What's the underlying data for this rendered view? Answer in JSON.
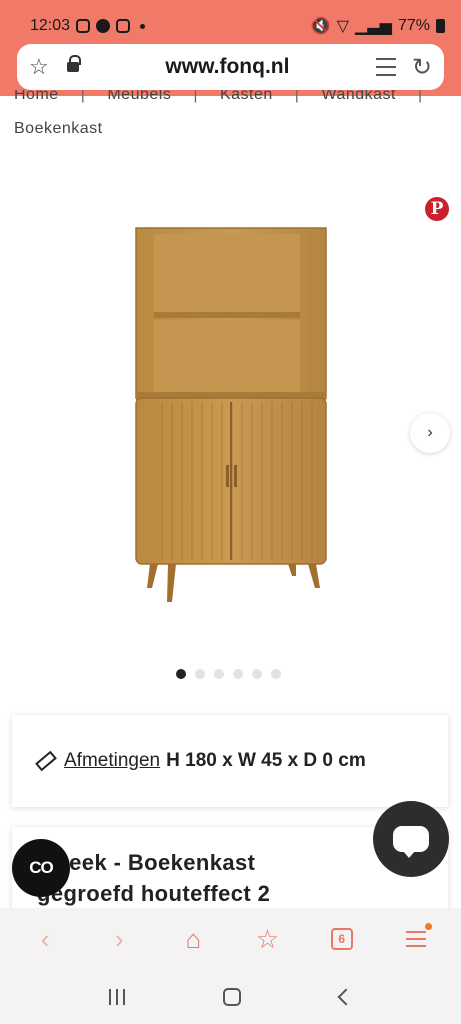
{
  "status_bar": {
    "time": "12:03",
    "battery": "77%"
  },
  "url_bar": {
    "url": "www.fonq.nl"
  },
  "breadcrumb": {
    "items": [
      "Home",
      "Meubels",
      "Kasten",
      "Wandkast"
    ],
    "separator": "|",
    "current": "Boekenkast"
  },
  "carousel": {
    "total_slides": 6,
    "active_index": 0
  },
  "dimensions": {
    "label": "Afmetingen",
    "value": "H 180 x W 45 x D 0 cm"
  },
  "product": {
    "title_line1": "...eeek - Boekenkast",
    "title_line2": "gegroefd houteffect 2"
  },
  "toolbar": {
    "tabs_count": "6"
  },
  "colors": {
    "brand": "#f07a67",
    "toolbar_icon": "#e57a67",
    "pinterest": "#c8232c",
    "chat_fab": "#2d2d2d"
  },
  "icons": {
    "url_star": "star-icon",
    "lock": "lock-icon",
    "reader": "reader-mode-icon",
    "reload": "reload-icon",
    "pinterest": "pinterest-icon",
    "ruler": "ruler-icon",
    "chat": "chat-icon"
  }
}
